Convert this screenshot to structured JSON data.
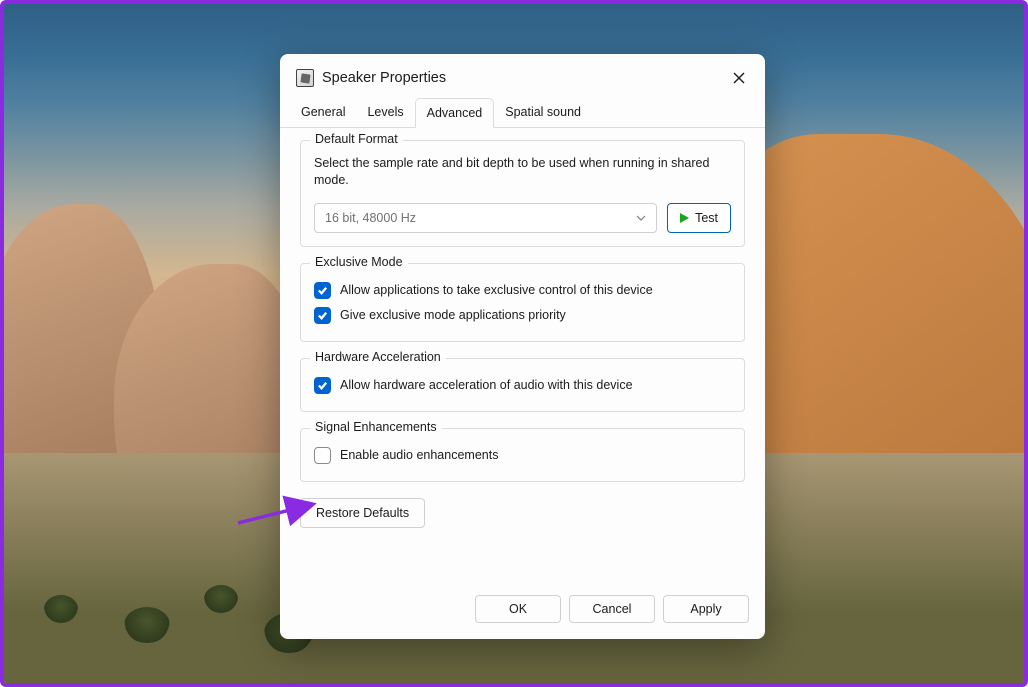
{
  "window": {
    "title": "Speaker Properties"
  },
  "tabs": [
    {
      "label": "General"
    },
    {
      "label": "Levels"
    },
    {
      "label": "Advanced",
      "active": true
    },
    {
      "label": "Spatial sound"
    }
  ],
  "default_format": {
    "title": "Default Format",
    "desc": "Select the sample rate and bit depth to be used when running in shared mode.",
    "value": "16 bit, 48000 Hz",
    "test_label": "Test"
  },
  "exclusive_mode": {
    "title": "Exclusive Mode",
    "opt1": {
      "label": "Allow applications to take exclusive control of this device",
      "checked": true
    },
    "opt2": {
      "label": "Give exclusive mode applications priority",
      "checked": true
    }
  },
  "hardware_accel": {
    "title": "Hardware Acceleration",
    "opt": {
      "label": "Allow hardware acceleration of audio with this device",
      "checked": true
    }
  },
  "signal_enh": {
    "title": "Signal Enhancements",
    "opt": {
      "label": "Enable audio enhancements",
      "checked": false
    }
  },
  "restore_label": "Restore Defaults",
  "footer": {
    "ok": "OK",
    "cancel": "Cancel",
    "apply": "Apply"
  }
}
